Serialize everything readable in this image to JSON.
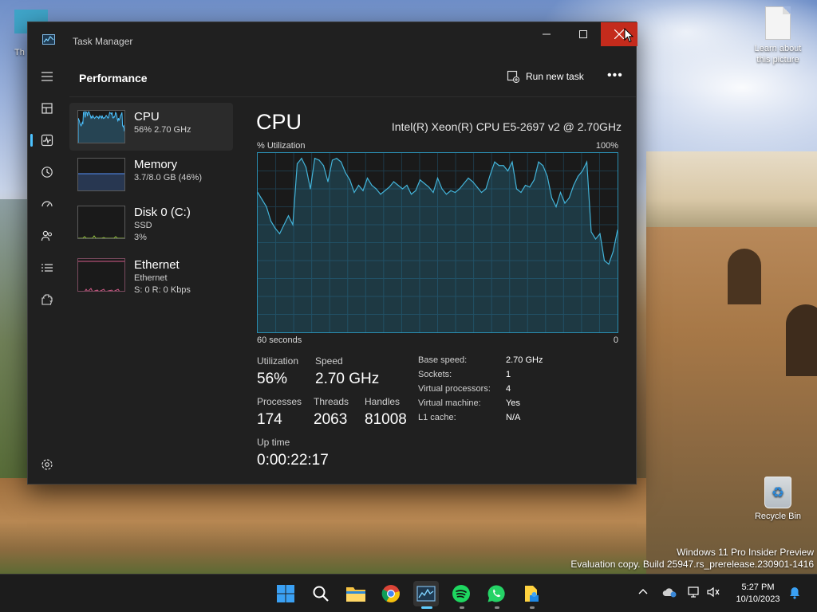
{
  "window": {
    "title": "Task Manager",
    "controls": {
      "minimize": "—",
      "maximize": "☐",
      "close": "✕"
    }
  },
  "header": {
    "title": "Performance",
    "run_new_task": "Run new task",
    "more": "•••"
  },
  "nav": {
    "items": [
      "menu-icon",
      "processes-icon",
      "performance-icon",
      "app-history-icon",
      "startup-apps-icon",
      "users-icon",
      "details-icon",
      "services-icon"
    ],
    "selected": "performance-icon",
    "settings": "settings-icon"
  },
  "resources": [
    {
      "name": "CPU",
      "line1": "56%  2.70 GHz",
      "line2": "",
      "selected": true,
      "color": "#4cc2ff"
    },
    {
      "name": "Memory",
      "line1": "3.7/8.0 GB (46%)",
      "line2": "",
      "selected": false,
      "color": "#4a7bd0"
    },
    {
      "name": "Disk 0 (C:)",
      "line1": "SSD",
      "line2": "3%",
      "selected": false,
      "color": "#9ac943"
    },
    {
      "name": "Ethernet",
      "line1": "Ethernet",
      "line2": "S: 0 R: 0 Kbps",
      "selected": false,
      "color": "#d55c8a"
    }
  ],
  "main": {
    "title": "CPU",
    "model": "Intel(R) Xeon(R) CPU E5-2697 v2 @ 2.70GHz",
    "util_label": "% Utilization",
    "max_label": "100%",
    "time_label": "60 seconds",
    "zero_label": "0",
    "stats": {
      "utilization_label": "Utilization",
      "utilization": "56%",
      "speed_label": "Speed",
      "speed": "2.70 GHz",
      "processes_label": "Processes",
      "processes": "174",
      "threads_label": "Threads",
      "threads": "2063",
      "handles_label": "Handles",
      "handles": "81008",
      "uptime_label": "Up time",
      "uptime": "0:00:22:17"
    },
    "info": {
      "base_speed_k": "Base speed:",
      "base_speed_v": "2.70 GHz",
      "sockets_k": "Sockets:",
      "sockets_v": "1",
      "vproc_k": "Virtual processors:",
      "vproc_v": "4",
      "vm_k": "Virtual machine:",
      "vm_v": "Yes",
      "l1_k": "L1 cache:",
      "l1_v": "N/A"
    },
    "graph_color": "#2a8db0"
  },
  "chart_data": {
    "type": "area",
    "title": "% Utilization",
    "xlabel": "60 seconds",
    "ylabel": "",
    "ylim": [
      0,
      100
    ],
    "values": [
      78,
      74,
      70,
      62,
      58,
      55,
      60,
      65,
      60,
      94,
      97,
      92,
      80,
      97,
      96,
      93,
      84,
      96,
      97,
      95,
      89,
      85,
      78,
      82,
      79,
      86,
      82,
      80,
      77,
      79,
      81,
      84,
      82,
      80,
      82,
      77,
      79,
      85,
      83,
      81,
      78,
      86,
      80,
      77,
      79,
      78,
      80,
      83,
      86,
      84,
      81,
      78,
      80,
      88,
      95,
      93,
      93,
      90,
      95,
      80,
      78,
      82,
      81,
      85,
      95,
      93,
      87,
      75,
      70,
      78,
      72,
      75,
      82,
      87,
      90,
      95,
      56,
      52,
      55,
      40,
      38,
      45,
      57
    ]
  },
  "desktop": {
    "icon_learn": "Learn about this picture",
    "icon_this": "Th",
    "icon_bin": "Recycle Bin",
    "watermark1": "Windows 11 Pro Insider Preview",
    "watermark2": "Evaluation copy. Build 25947.rs_prerelease.230901-1416"
  },
  "taskbar": {
    "apps": [
      "start-icon",
      "search-icon",
      "file-explorer-icon",
      "chrome-icon",
      "task-manager-icon",
      "spotify-icon",
      "whatsapp-icon",
      "files-app-icon"
    ],
    "active_app": "task-manager-icon",
    "time": "5:27 PM",
    "date": "10/10/2023"
  }
}
